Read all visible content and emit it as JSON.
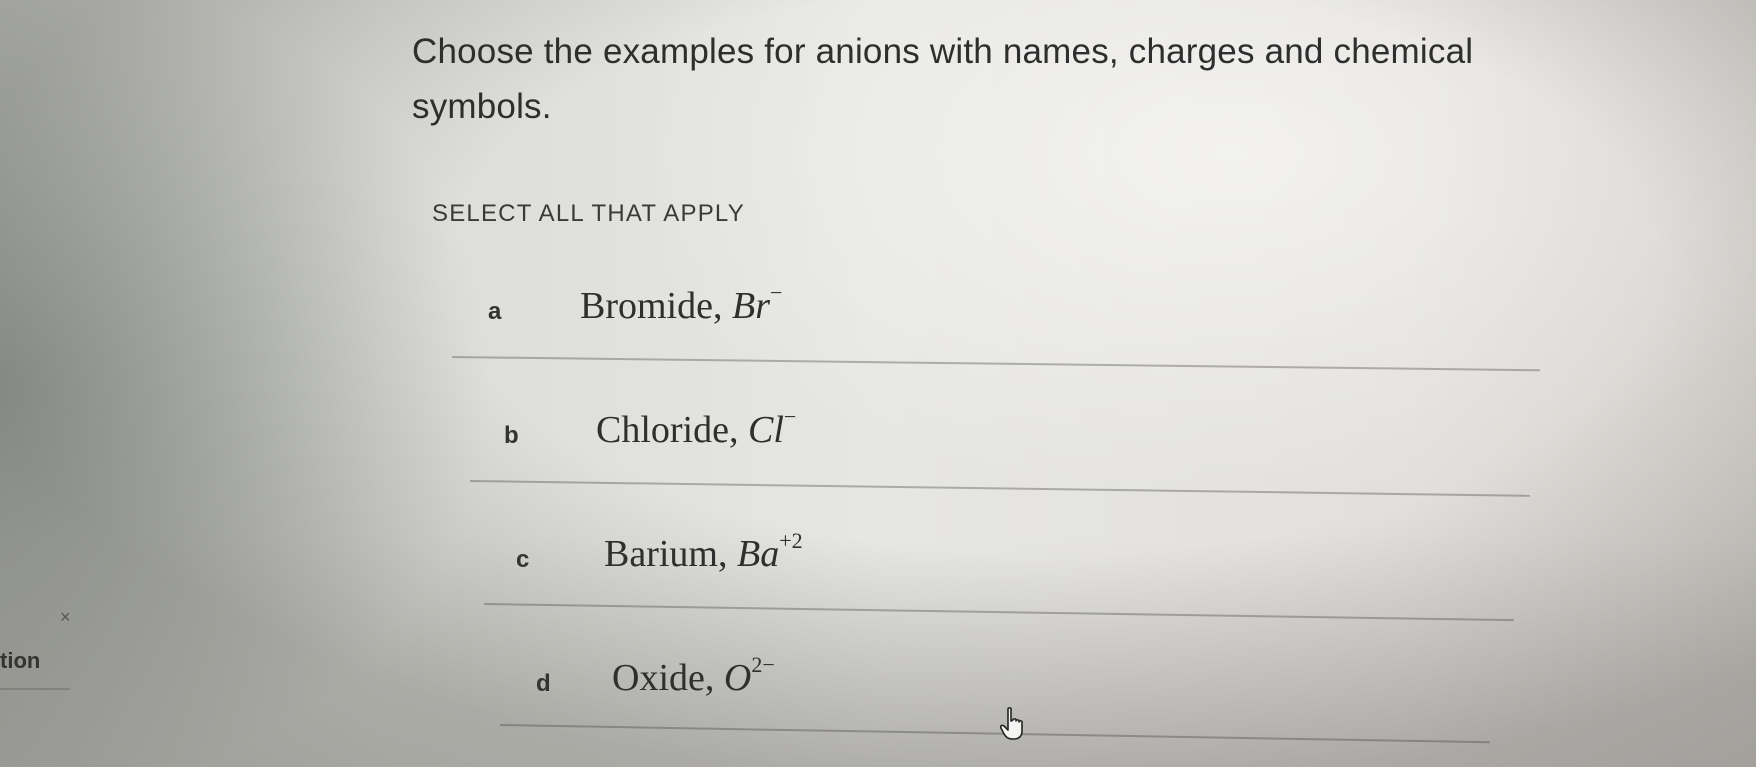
{
  "question": {
    "text": "Choose the examples for anions with names, charges and chemical symbols."
  },
  "instruction": {
    "text": "SELECT ALL THAT APPLY"
  },
  "options": [
    {
      "letter": "a",
      "name": "Bromide,",
      "symbol": "Br",
      "charge": "−"
    },
    {
      "letter": "b",
      "name": "Chloride,",
      "symbol": "Cl",
      "charge": "−"
    },
    {
      "letter": "c",
      "name": "Barium,",
      "symbol": "Ba",
      "charge": "+2"
    },
    {
      "letter": "d",
      "name": "Oxide,",
      "symbol": "O",
      "charge": "2−"
    }
  ],
  "sidebar": {
    "close_glyph": "×",
    "partial_label": "tion"
  },
  "icons": {
    "cursor": "hand-pointer-icon"
  }
}
